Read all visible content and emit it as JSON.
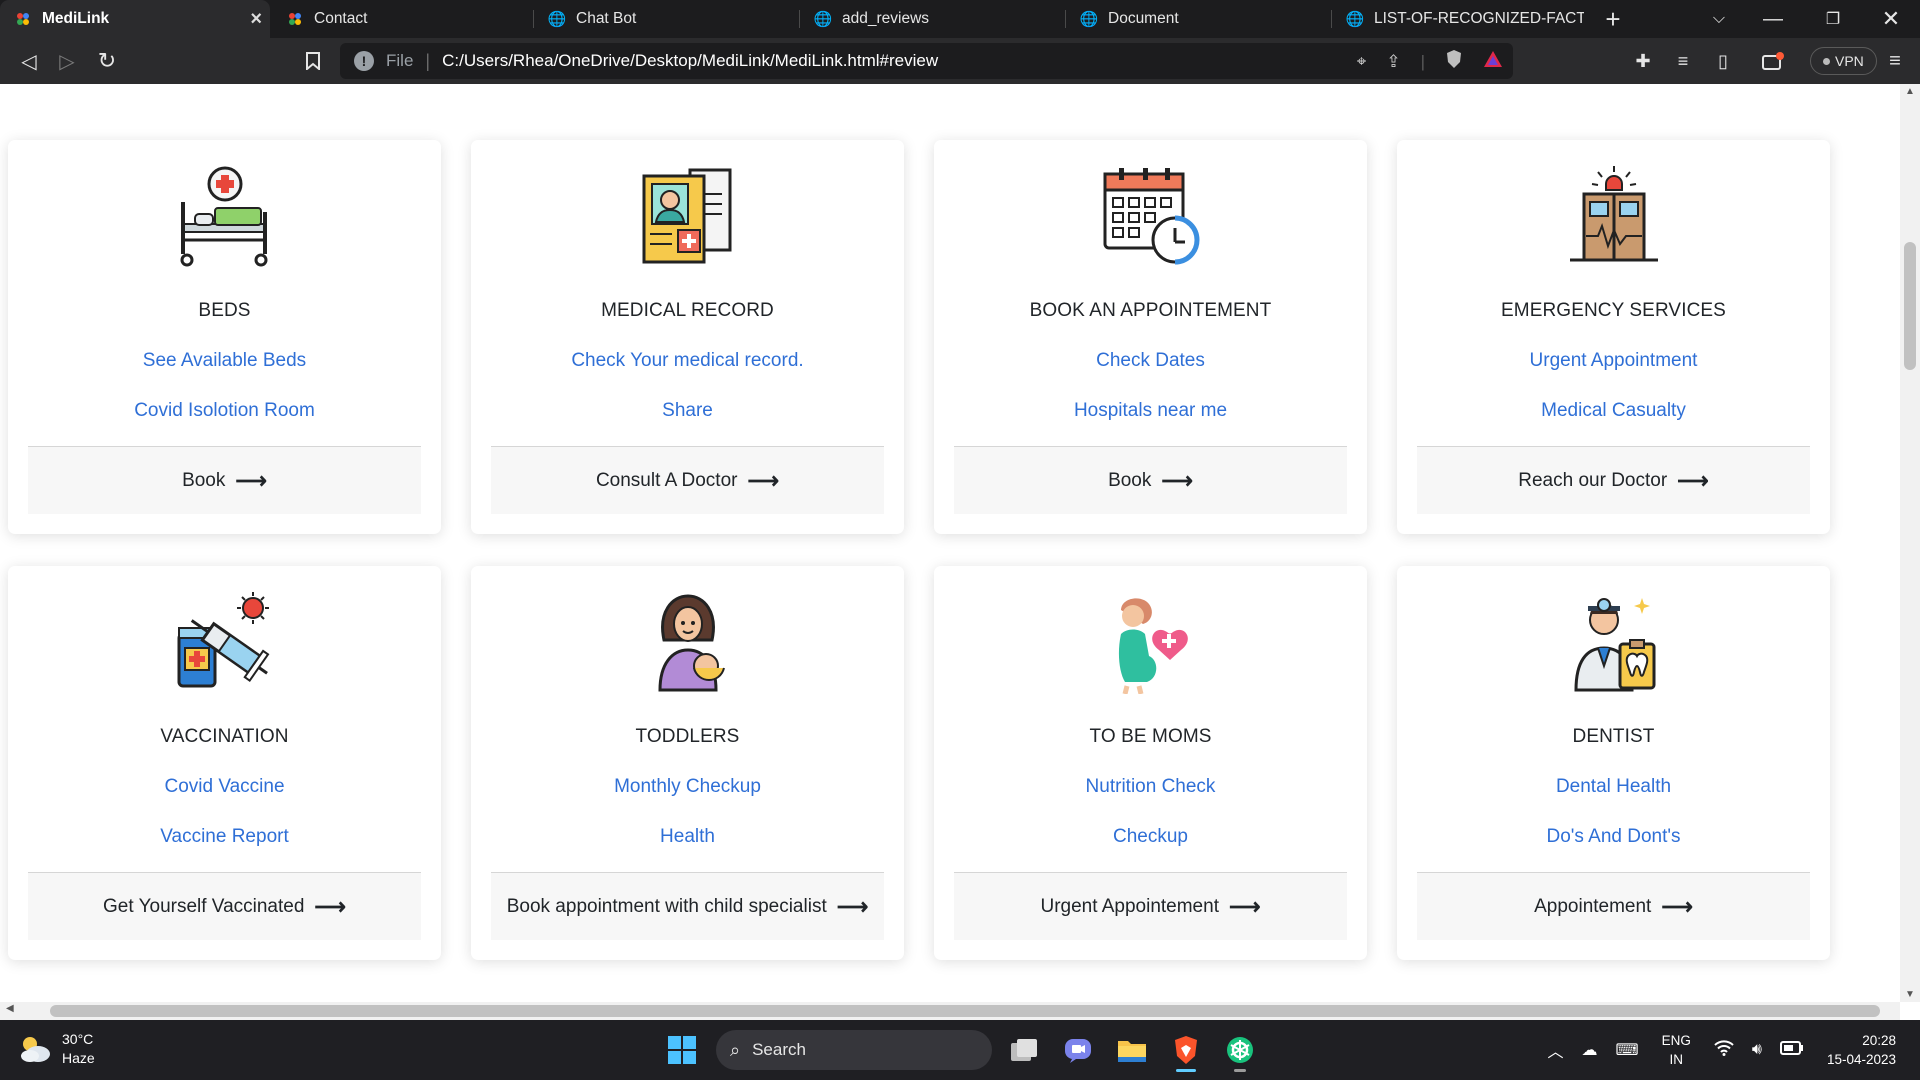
{
  "browser": {
    "tabs": [
      {
        "label": "MediLink",
        "active": true
      },
      {
        "label": "Contact",
        "active": false
      },
      {
        "label": "Chat Bot",
        "active": false
      },
      {
        "label": "add_reviews",
        "active": false
      },
      {
        "label": "Document",
        "active": false
      },
      {
        "label": "LIST-OF-RECOGNIZED-FACTORY",
        "active": false
      }
    ],
    "address": {
      "scheme_label": "File",
      "url": "C:/Users/Rhea/OneDrive/Desktop/MediLink/MediLink.html#review"
    },
    "vpn_label": "VPN"
  },
  "cards": [
    {
      "title": "BEDS",
      "link1": "See Available Beds",
      "link2": "Covid Isolotion Room",
      "action": "Book",
      "icon": "hospital-bed-icon"
    },
    {
      "title": "MEDICAL RECORD",
      "link1": "Check Your medical record.",
      "link2": "Share",
      "action": "Consult A Doctor",
      "icon": "medical-record-icon"
    },
    {
      "title": "BOOK AN APPOINTEMENT",
      "link1": "Check Dates",
      "link2": "Hospitals near me",
      "action": "Book",
      "icon": "calendar-clock-icon"
    },
    {
      "title": "EMERGENCY SERVICES",
      "link1": "Urgent Appointment",
      "link2": "Medical Casualty",
      "action": "Reach our Doctor",
      "icon": "emergency-door-icon"
    },
    {
      "title": "VACCINATION",
      "link1": "Covid Vaccine",
      "link2": "Vaccine Report",
      "action": "Get Yourself Vaccinated",
      "icon": "vaccine-syringe-icon"
    },
    {
      "title": "TODDLERS",
      "link1": "Monthly Checkup",
      "link2": "Health",
      "action": "Book appointment with child specialist",
      "icon": "mother-baby-icon"
    },
    {
      "title": "TO BE MOMS",
      "link1": "Nutrition Check",
      "link2": "Checkup",
      "action": "Urgent Appointement",
      "icon": "pregnant-woman-icon"
    },
    {
      "title": "DENTIST",
      "link1": "Dental Health",
      "link2": "Do's And Dont's",
      "action": "Appointement",
      "icon": "dentist-icon"
    }
  ],
  "colors": {
    "link": "#2f6fd6",
    "footer_bg": "#f7f7f7",
    "browser_dark": "#1c1c1e",
    "taskbar": "#1f1f23"
  },
  "taskbar": {
    "weather_temp": "30°C",
    "weather_desc": "Haze",
    "search_label": "Search",
    "lang_top": "ENG",
    "lang_bottom": "IN",
    "time": "20:28",
    "date": "15-04-2023"
  }
}
